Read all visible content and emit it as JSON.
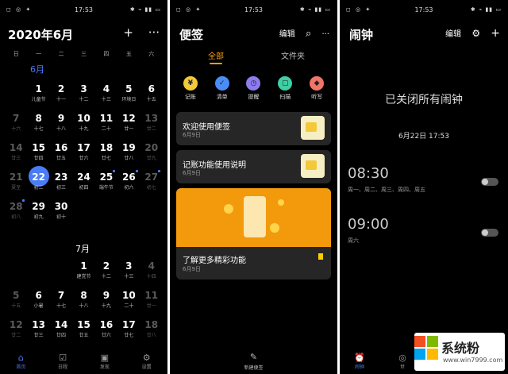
{
  "status": {
    "time": "17:53",
    "left": "◻ ◎ ✦",
    "right": "✱ ⌁ ▮▮ ▭"
  },
  "calendar": {
    "title": "2020年6月",
    "add_icon": "+",
    "more_icon": "···",
    "weekdays": [
      "日",
      "一",
      "二",
      "三",
      "四",
      "五",
      "六"
    ],
    "june_label": "6月",
    "july_label": "7月",
    "june": [
      [
        {
          "n": "",
          "s": ""
        },
        {
          "n": "1",
          "s": "儿童节"
        },
        {
          "n": "2",
          "s": "十一"
        },
        {
          "n": "3",
          "s": "十二"
        },
        {
          "n": "4",
          "s": "十三"
        },
        {
          "n": "5",
          "s": "环境日"
        },
        {
          "n": "6",
          "s": "十五"
        }
      ],
      [
        {
          "n": "7",
          "s": "十六",
          "dim": true
        },
        {
          "n": "8",
          "s": "十七"
        },
        {
          "n": "9",
          "s": "十八"
        },
        {
          "n": "10",
          "s": "十九"
        },
        {
          "n": "11",
          "s": "二十"
        },
        {
          "n": "12",
          "s": "廿一"
        },
        {
          "n": "13",
          "s": "廿二",
          "dim": true
        }
      ],
      [
        {
          "n": "14",
          "s": "廿三",
          "dim": true
        },
        {
          "n": "15",
          "s": "廿四"
        },
        {
          "n": "16",
          "s": "廿五"
        },
        {
          "n": "17",
          "s": "廿六"
        },
        {
          "n": "18",
          "s": "廿七"
        },
        {
          "n": "19",
          "s": "廿八"
        },
        {
          "n": "20",
          "s": "廿九",
          "dim": true
        }
      ],
      [
        {
          "n": "21",
          "s": "夏至",
          "dim": true
        },
        {
          "n": "22",
          "s": "初二",
          "today": true
        },
        {
          "n": "23",
          "s": "初三"
        },
        {
          "n": "24",
          "s": "初四"
        },
        {
          "n": "25",
          "s": "端午节",
          "dot": true
        },
        {
          "n": "26",
          "s": "初六",
          "dot": true
        },
        {
          "n": "27",
          "s": "初七",
          "dim": true,
          "dot": true
        }
      ],
      [
        {
          "n": "28",
          "s": "初八",
          "dim": true,
          "dot": true
        },
        {
          "n": "29",
          "s": "初九"
        },
        {
          "n": "30",
          "s": "初十"
        },
        {
          "n": "",
          "s": ""
        },
        {
          "n": "",
          "s": ""
        },
        {
          "n": "",
          "s": ""
        },
        {
          "n": "",
          "s": ""
        }
      ]
    ],
    "july": [
      [
        {
          "n": "",
          "s": ""
        },
        {
          "n": "",
          "s": ""
        },
        {
          "n": "",
          "s": ""
        },
        {
          "n": "1",
          "s": "建党节"
        },
        {
          "n": "2",
          "s": "十二"
        },
        {
          "n": "3",
          "s": "十三"
        },
        {
          "n": "4",
          "s": "十四",
          "dim": true
        }
      ],
      [
        {
          "n": "5",
          "s": "十五",
          "dim": true
        },
        {
          "n": "6",
          "s": "小暑"
        },
        {
          "n": "7",
          "s": "十七"
        },
        {
          "n": "8",
          "s": "十八"
        },
        {
          "n": "9",
          "s": "十九"
        },
        {
          "n": "10",
          "s": "二十"
        },
        {
          "n": "11",
          "s": "廿一",
          "dim": true
        }
      ],
      [
        {
          "n": "12",
          "s": "廿二",
          "dim": true
        },
        {
          "n": "13",
          "s": "廿三"
        },
        {
          "n": "14",
          "s": "廿四"
        },
        {
          "n": "15",
          "s": "廿五"
        },
        {
          "n": "16",
          "s": "廿六"
        },
        {
          "n": "17",
          "s": "廿七"
        },
        {
          "n": "18",
          "s": "廿八",
          "dim": true
        }
      ]
    ],
    "tabs": [
      {
        "label": "首页",
        "icon": "⌂",
        "active": true
      },
      {
        "label": "日程",
        "icon": "☑"
      },
      {
        "label": "发现",
        "icon": "▣"
      },
      {
        "label": "设置",
        "icon": "⚙"
      }
    ]
  },
  "notes": {
    "title": "便签",
    "edit": "编辑",
    "search_icon": "⌕",
    "more_icon": "···",
    "tab_all": "全部",
    "tab_folder": "文件夹",
    "quick": [
      {
        "label": "记账",
        "icon": "¥",
        "color": "#f3c93a"
      },
      {
        "label": "清单",
        "icon": "✓",
        "color": "#4a8df5"
      },
      {
        "label": "提醒",
        "icon": "◷",
        "color": "#8d7cf0"
      },
      {
        "label": "扫描",
        "icon": "▢",
        "color": "#3ecfa5"
      },
      {
        "label": "听写",
        "icon": "◆",
        "color": "#f0756b"
      }
    ],
    "cards": [
      {
        "title": "欢迎使用便签",
        "date": "6月9日"
      },
      {
        "title": "记账功能使用说明",
        "date": "6月9日"
      }
    ],
    "promo": {
      "title": "了解更多精彩功能",
      "date": "6月9日"
    },
    "new_note": "新建便签",
    "new_note_icon": "✎"
  },
  "alarm": {
    "title": "闹钟",
    "edit": "编辑",
    "settings_icon": "⚙",
    "add_icon": "+",
    "status": "已关闭所有闹钟",
    "next": "6月22日 17:53",
    "alarms": [
      {
        "time": "08:30",
        "repeat": "周一、周二、周三、周四、周五"
      },
      {
        "time": "09:00",
        "repeat": "周六"
      }
    ],
    "tab_alarm": "闹钟",
    "tab_alarm_icon": "⏰",
    "tab_world": "世",
    "tab_world_icon": "◎",
    "watermark": "系统粉",
    "watermark_url": "www.win7999.com",
    "ms_colors": [
      "#f25022",
      "#7fba00",
      "#00a4ef",
      "#ffb900"
    ]
  }
}
